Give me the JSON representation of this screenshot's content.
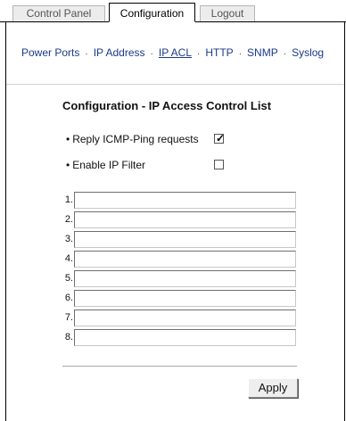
{
  "tabs": [
    {
      "label": "Control Panel",
      "active": false
    },
    {
      "label": "Configuration",
      "active": true
    },
    {
      "label": "Logout",
      "active": false
    }
  ],
  "subnav": {
    "items": [
      "Power Ports",
      "IP Address",
      "IP ACL",
      "HTTP",
      "SNMP",
      "Syslog"
    ],
    "current": "IP ACL",
    "separator": "·"
  },
  "page_title": "Configuration - IP Access Control List",
  "options": {
    "reply_icmp": {
      "label": "Reply ICMP-Ping requests",
      "checked": true
    },
    "enable_ip_filter": {
      "label": "Enable IP Filter",
      "checked": false
    }
  },
  "bullet": "•",
  "checkmark": "✓",
  "acl_entries": [
    {
      "number": "1.",
      "value": ""
    },
    {
      "number": "2.",
      "value": ""
    },
    {
      "number": "3.",
      "value": ""
    },
    {
      "number": "4.",
      "value": ""
    },
    {
      "number": "5.",
      "value": ""
    },
    {
      "number": "6.",
      "value": ""
    },
    {
      "number": "7.",
      "value": ""
    },
    {
      "number": "8.",
      "value": ""
    }
  ],
  "apply_label": "Apply",
  "colors": {
    "link": "#1a3a8a",
    "frame": "#000000"
  }
}
